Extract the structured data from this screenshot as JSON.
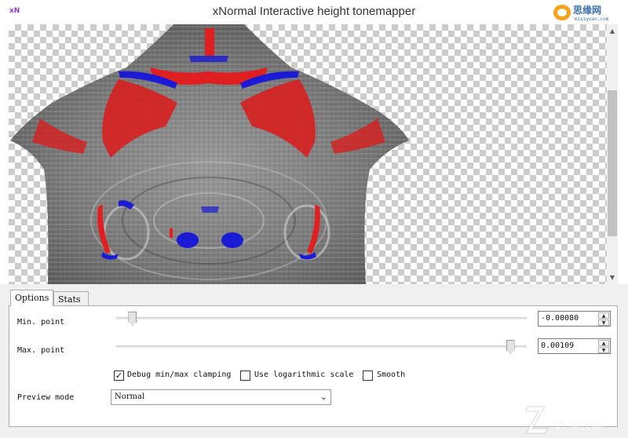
{
  "window": {
    "app_icon_text": "xN",
    "title": "xNormal Interactive height tonemapper",
    "watermark_top": "思缘网",
    "watermark_top_sub": "missyuan.com"
  },
  "tabs": [
    {
      "label": "Options",
      "active": true
    },
    {
      "label": "Stats",
      "active": false
    }
  ],
  "options": {
    "min_point": {
      "label": "Min. point",
      "value": "-0.00080",
      "slider_fraction": 0.04
    },
    "max_point": {
      "label": "Max. point",
      "value": "0.00109",
      "slider_fraction": 0.96
    },
    "debug_clamping": {
      "label": "Debug min/max clamping",
      "checked": true
    },
    "log_scale": {
      "label": "Use logarithmic scale",
      "checked": false
    },
    "smooth": {
      "label": "Smooth",
      "checked": false
    },
    "preview_mode": {
      "label": "Preview mode",
      "value": "Normal"
    }
  },
  "watermark_bottom": {
    "text": "朱峰社区",
    "sub": "ZF3D.COM"
  },
  "icons": {
    "check": "✓",
    "scroll_up": "▲",
    "scroll_down": "▼",
    "spin_up": "▲",
    "spin_down": "▼",
    "dropdown": "⌄"
  },
  "colors": {
    "clamp_high": "#e02020",
    "clamp_low": "#1b1bd6",
    "checker": "#cccccc"
  }
}
